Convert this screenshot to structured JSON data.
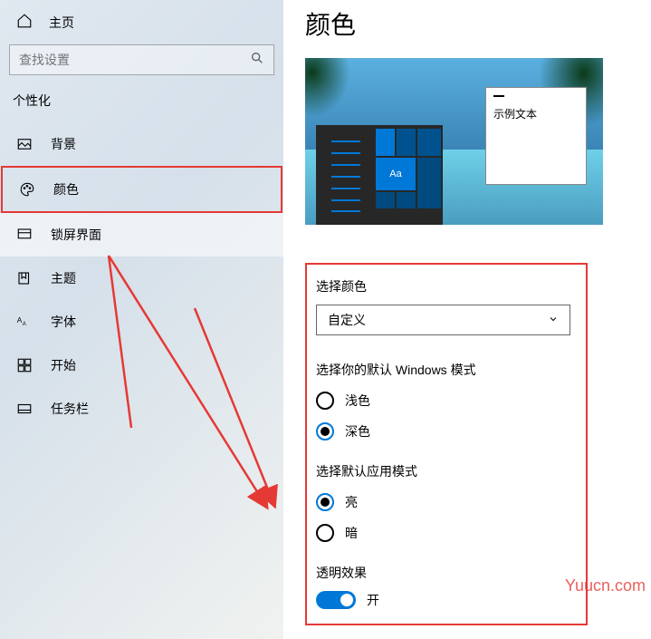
{
  "sidebar": {
    "home": "主页",
    "search_placeholder": "查找设置",
    "section": "个性化",
    "items": [
      {
        "label": "背景"
      },
      {
        "label": "颜色"
      },
      {
        "label": "锁屏界面"
      },
      {
        "label": "主题"
      },
      {
        "label": "字体"
      },
      {
        "label": "开始"
      },
      {
        "label": "任务栏"
      }
    ]
  },
  "main": {
    "title": "颜色",
    "preview": {
      "tile_label": "Aa",
      "window_text": "示例文本"
    },
    "select_color": {
      "label": "选择颜色",
      "value": "自定义"
    },
    "windows_mode": {
      "label": "选择你的默认 Windows 模式",
      "light": "浅色",
      "dark": "深色"
    },
    "app_mode": {
      "label": "选择默认应用模式",
      "light": "亮",
      "dark": "暗"
    },
    "transparency": {
      "label": "透明效果",
      "state": "开"
    }
  },
  "watermark": "Yuucn.com"
}
